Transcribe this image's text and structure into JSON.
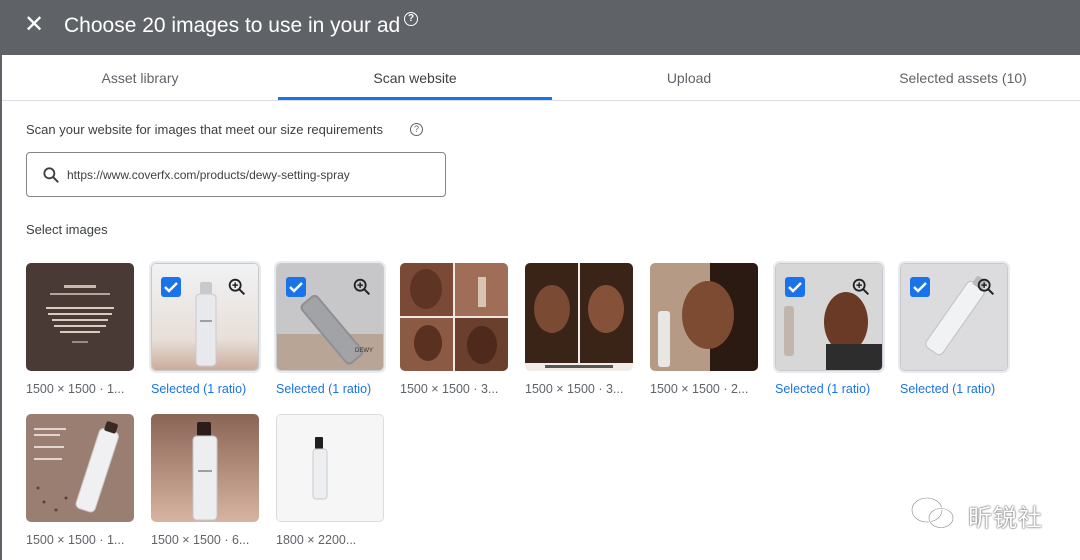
{
  "header": {
    "close_icon": "close-icon",
    "title": "Choose 20 images to use in your ad",
    "help_glyph": "?"
  },
  "tabs": [
    {
      "label": "Asset library",
      "active": false
    },
    {
      "label": "Scan website",
      "active": true
    },
    {
      "label": "Upload",
      "active": false
    },
    {
      "label": "Selected assets (10)",
      "active": false
    }
  ],
  "scan": {
    "label": "Scan your website for images that meet our size requirements",
    "help_glyph": "?",
    "url_value": "https://www.coverfx.com/products/dewy-setting-spray"
  },
  "select_label": "Select images",
  "images": [
    {
      "caption": "1500 × 1500 · 1...",
      "selected": false
    },
    {
      "caption": "Selected (1 ratio)",
      "selected": true
    },
    {
      "caption": "Selected (1 ratio)",
      "selected": true
    },
    {
      "caption": "1500 × 1500 · 3...",
      "selected": false
    },
    {
      "caption": "1500 × 1500 · 3...",
      "selected": false
    },
    {
      "caption": "1500 × 1500 · 2...",
      "selected": false
    },
    {
      "caption": "Selected (1 ratio)",
      "selected": true
    },
    {
      "caption": "Selected (1 ratio)",
      "selected": true
    },
    {
      "caption": "1500 × 1500 · 1...",
      "selected": false
    },
    {
      "caption": "1500 × 1500 · 6...",
      "selected": false
    },
    {
      "caption": "1800 × 2200...",
      "selected": false
    }
  ],
  "watermark": {
    "text": "昕锐社"
  },
  "colors": {
    "header": "#5f6368",
    "accent": "#1a73e8",
    "selected_text": "#1a73e8"
  }
}
